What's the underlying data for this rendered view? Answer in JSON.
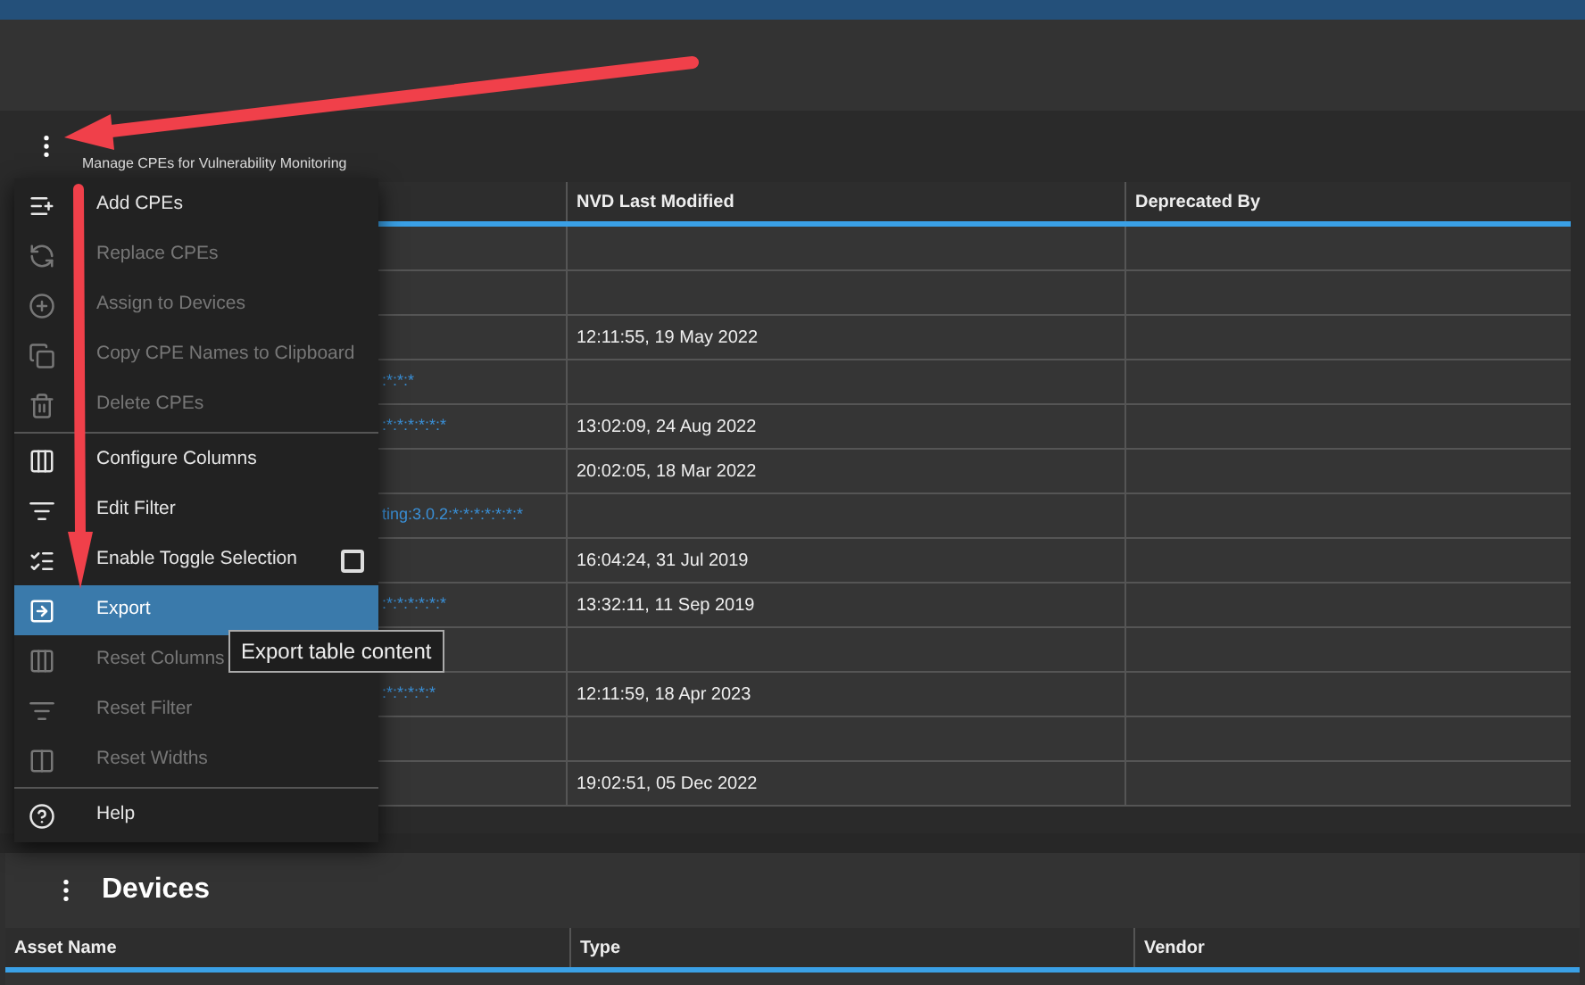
{
  "panel": {
    "subtitle": "Manage CPEs for Vulnerability Monitoring"
  },
  "table": {
    "columns": [
      "",
      "NVD Last Modified",
      "Deprecated By"
    ],
    "rows": [
      {
        "cells": [
          "",
          ""
        ]
      },
      {
        "cells": [
          "",
          ""
        ]
      },
      {
        "cells": [
          "",
          "12:11:55, 19 May 2022"
        ]
      },
      {
        "cells": [
          ":*:*:*",
          ""
        ]
      },
      {
        "cells": [
          ":*:*:*:*:*:*",
          "13:02:09, 24 Aug 2022"
        ]
      },
      {
        "cells": [
          "",
          "20:02:05, 18 Mar 2022"
        ]
      },
      {
        "cells": [
          "ting:3.0.2:*:*:*:*:*:*:*",
          ""
        ]
      },
      {
        "cells": [
          "",
          "16:04:24, 31 Jul 2019"
        ]
      },
      {
        "cells": [
          ":*:*:*:*:*:*",
          "13:32:11, 11 Sep 2019"
        ]
      },
      {
        "cells": [
          "",
          ""
        ]
      },
      {
        "cells": [
          ":*:*:*:*:*",
          "12:11:59, 18 Apr 2023"
        ]
      },
      {
        "cells": [
          "",
          ""
        ]
      },
      {
        "cells": [
          "",
          "19:02:51, 05 Dec 2022"
        ]
      }
    ]
  },
  "menu": {
    "items": [
      {
        "kind": "add",
        "label": "Add CPEs",
        "disabled": false,
        "selected": false
      },
      {
        "kind": "replace",
        "label": "Replace CPEs",
        "disabled": true,
        "selected": false
      },
      {
        "kind": "assign",
        "label": "Assign to Devices",
        "disabled": true,
        "selected": false
      },
      {
        "kind": "copy",
        "label": "Copy CPE Names to Clipboard",
        "disabled": true,
        "selected": false
      },
      {
        "kind": "delete",
        "label": "Delete CPEs",
        "disabled": true,
        "selected": false,
        "divider_after": true
      },
      {
        "kind": "columns",
        "label": "Configure Columns",
        "disabled": false,
        "selected": false
      },
      {
        "kind": "filter",
        "label": "Edit Filter",
        "disabled": false,
        "selected": false
      },
      {
        "kind": "toggle",
        "label": "Enable Toggle Selection",
        "disabled": false,
        "selected": false,
        "checked": false
      },
      {
        "kind": "export",
        "label": "Export",
        "disabled": false,
        "selected": true
      },
      {
        "kind": "reset-columns",
        "label": "Reset Columns",
        "disabled": true,
        "selected": false
      },
      {
        "kind": "reset-filter",
        "label": "Reset Filter",
        "disabled": true,
        "selected": false
      },
      {
        "kind": "reset-widths",
        "label": "Reset Widths",
        "disabled": true,
        "selected": false,
        "divider_after": true
      },
      {
        "kind": "help",
        "label": "Help",
        "disabled": false,
        "selected": false
      }
    ]
  },
  "tooltip": "Export table content",
  "devices": {
    "title": "Devices",
    "columns": [
      "Asset Name",
      "Type",
      "Vendor"
    ]
  }
}
